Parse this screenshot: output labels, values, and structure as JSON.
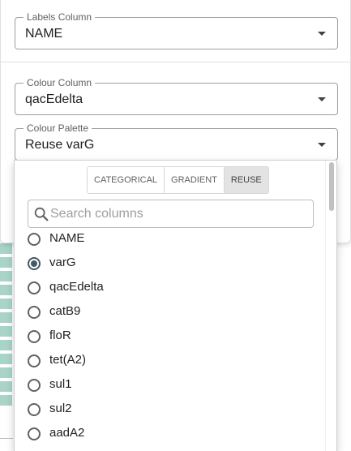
{
  "labels_field": {
    "label": "Labels Column",
    "value": "NAME"
  },
  "colour_field": {
    "label": "Colour Column",
    "value": "qacEdelta"
  },
  "palette_field": {
    "label": "Colour Palette",
    "value": "Reuse varG"
  },
  "palette_dropdown": {
    "tabs": [
      "CATEGORICAL",
      "GRADIENT",
      "REUSE"
    ],
    "active_tab": "REUSE",
    "search": {
      "placeholder": "Search columns",
      "value": ""
    },
    "options": [
      {
        "label": "NAME",
        "selected": false
      },
      {
        "label": "varG",
        "selected": true
      },
      {
        "label": "qacEdelta",
        "selected": false
      },
      {
        "label": "catB9",
        "selected": false
      },
      {
        "label": "floR",
        "selected": false
      },
      {
        "label": "tet(A2)",
        "selected": false
      },
      {
        "label": "sul1",
        "selected": false
      },
      {
        "label": "sul2",
        "selected": false
      },
      {
        "label": "aadA2",
        "selected": false
      }
    ]
  },
  "colors": {
    "accent": "#455a64",
    "legend_tile": "#a8d5c8"
  }
}
